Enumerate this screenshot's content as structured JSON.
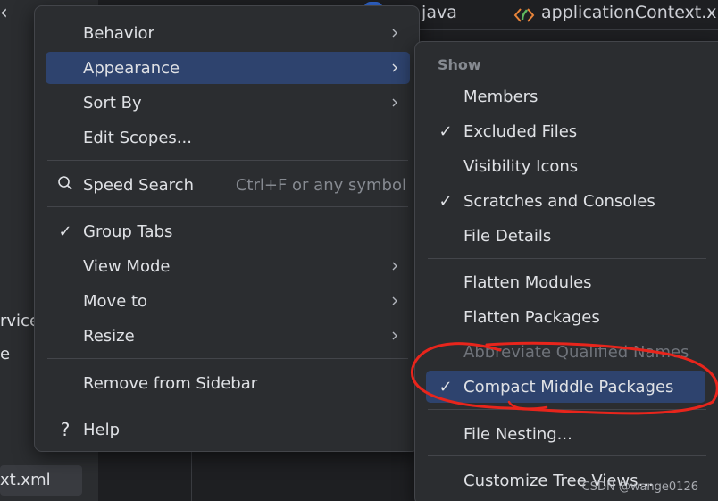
{
  "background": {
    "tabs": [
      ".java",
      "applicationContext.xml"
    ],
    "sidebar_fragments": [
      "rvice",
      "e"
    ],
    "selected_file": "xt.xml"
  },
  "main_menu": {
    "items": [
      {
        "label": "Behavior",
        "submenu": true
      },
      {
        "label": "Appearance",
        "submenu": true,
        "selected": true
      },
      {
        "label": "Sort By",
        "submenu": true
      },
      {
        "label": "Edit Scopes..."
      },
      {
        "label": "Speed Search",
        "shortcut": "Ctrl+F or any symbol",
        "icon": "search-icon"
      },
      {
        "label": "Group Tabs",
        "checked": true
      },
      {
        "label": "View Mode",
        "submenu": true
      },
      {
        "label": "Move to",
        "submenu": true
      },
      {
        "label": "Resize",
        "submenu": true
      },
      {
        "label": "Remove from Sidebar"
      },
      {
        "label": "Help",
        "icon": "help-icon"
      }
    ]
  },
  "appearance_submenu": {
    "section_header": "Show",
    "items": [
      {
        "label": "Members"
      },
      {
        "label": "Excluded Files",
        "checked": true
      },
      {
        "label": "Visibility Icons"
      },
      {
        "label": "Scratches and Consoles",
        "checked": true
      },
      {
        "label": "File Details"
      },
      {
        "label": "Flatten Modules"
      },
      {
        "label": "Flatten Packages"
      },
      {
        "label": "Abbreviate Qualified Names",
        "disabled": true
      },
      {
        "label": "Compact Middle Packages",
        "checked": true,
        "selected": true
      },
      {
        "label": "File Nesting..."
      },
      {
        "label": "Customize Tree Views..."
      }
    ]
  },
  "watermark": "CSDN @wange0126",
  "colors": {
    "menu_bg": "#2b2d30",
    "selection": "#2e436e",
    "annotation": "#e8251c"
  }
}
